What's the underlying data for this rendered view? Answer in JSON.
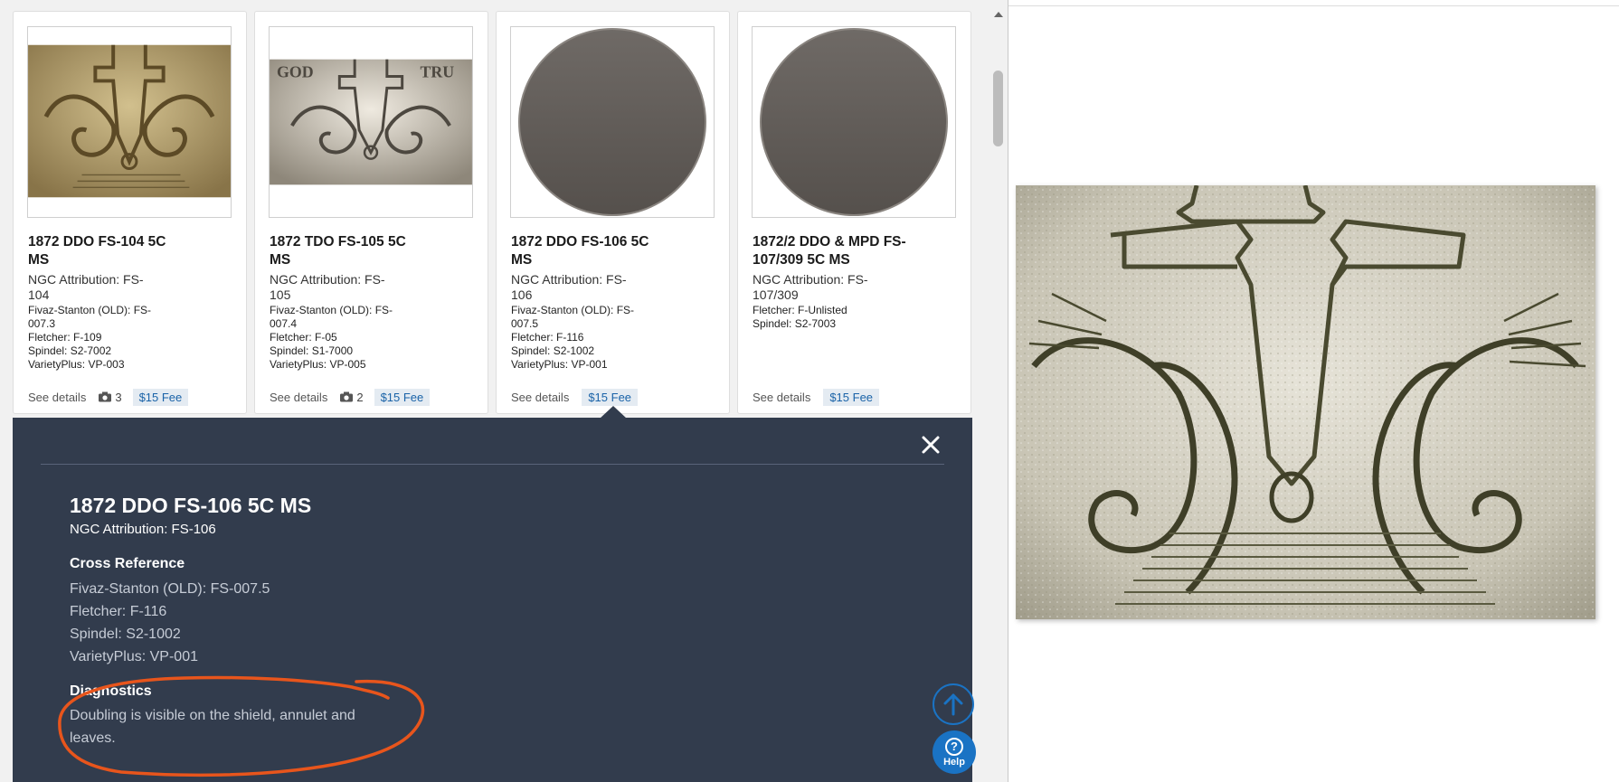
{
  "cards": [
    {
      "title": "1872 DDO FS-104 5C MS",
      "attribution": "NGC Attribution: FS-104",
      "refs": [
        "Fivaz-Stanton (OLD): FS-007.3",
        "Fletcher: F-109",
        "Spindel: S2-7002",
        "VarietyPlus: VP-003"
      ],
      "see_details": "See details",
      "photo_count": "3",
      "fee": "$15 Fee",
      "image": "coin-shield-closeup"
    },
    {
      "title": "1872 TDO FS-105 5C MS",
      "attribution": "NGC Attribution: FS-105",
      "refs": [
        "Fivaz-Stanton (OLD): FS-007.4",
        "Fletcher: F-05",
        "Spindel: S1-7000",
        "VarietyPlus: VP-005"
      ],
      "see_details": "See details",
      "photo_count": "2",
      "fee": "$15 Fee",
      "image": "coin-shield-closeup"
    },
    {
      "title": "1872 DDO FS-106 5C MS",
      "attribution": "NGC Attribution: FS-106",
      "refs": [
        "Fivaz-Stanton (OLD): FS-007.5",
        "Fletcher: F-116",
        "Spindel: S2-1002",
        "VarietyPlus: VP-001"
      ],
      "see_details": "See details",
      "photo_count": "",
      "fee": "$15 Fee",
      "image": "coin-placeholder"
    },
    {
      "title": "1872/2 DDO & MPD FS-107/309 5C MS",
      "attribution": "NGC Attribution: FS-107/309",
      "refs": [
        "Fletcher: F-Unlisted",
        "Spindel: S2-7003"
      ],
      "see_details": "See details",
      "photo_count": "",
      "fee": "$15 Fee",
      "image": "coin-placeholder"
    }
  ],
  "detail": {
    "title": "1872 DDO FS-106 5C MS",
    "attribution": "NGC Attribution: FS-106",
    "cross_reference_heading": "Cross Reference",
    "cross_references": [
      "Fivaz-Stanton (OLD): FS-007.5",
      "Fletcher: F-116",
      "Spindel: S2-1002",
      "VarietyPlus: VP-001"
    ],
    "diagnostics_heading": "Diagnostics",
    "diagnostics_text": "Doubling is visible on the shield, annulet and leaves.",
    "close_icon": "close-icon",
    "annotation_color": "#e8551c"
  },
  "help": {
    "label": "Help",
    "symbol": "?"
  },
  "colors": {
    "panel_bg": "#323c4d",
    "accent_blue": "#1a73c4",
    "fee_bg": "#e4ebf2",
    "fee_text": "#1a63a8"
  }
}
